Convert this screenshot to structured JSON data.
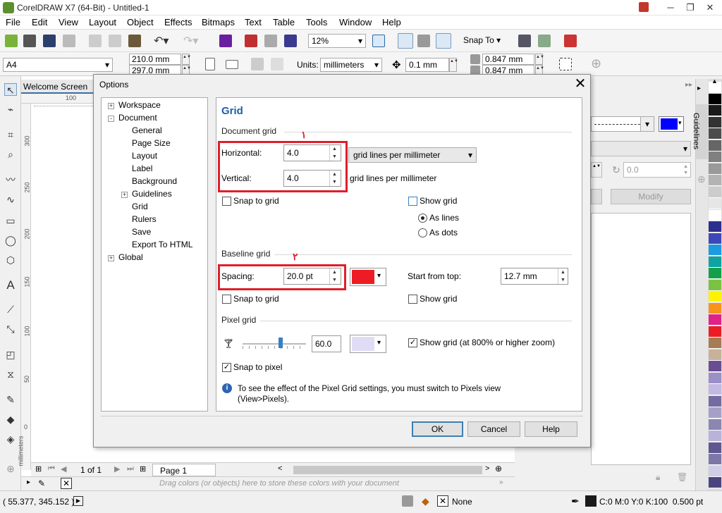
{
  "window": {
    "title": "CorelDRAW X7 (64-Bit) - Untitled-1"
  },
  "menu": [
    "File",
    "Edit",
    "View",
    "Layout",
    "Object",
    "Effects",
    "Bitmaps",
    "Text",
    "Table",
    "Tools",
    "Window",
    "Help"
  ],
  "toolbar": {
    "zoom": "12%",
    "snap_to": "Snap To"
  },
  "propbar": {
    "page_size": "A4",
    "width": "210.0 mm",
    "height": "297.0 mm",
    "units_label": "Units:",
    "units_value": "millimeters",
    "nudge": "0.1 mm",
    "dup_x": "0.847 mm",
    "dup_y": "0.847 mm"
  },
  "tabs": {
    "welcome": "Welcome Screen"
  },
  "ruler": {
    "h_100": "100",
    "v_labels": [
      "300",
      "250",
      "200",
      "150",
      "100",
      "50",
      "0"
    ],
    "v_unit": "millimeters"
  },
  "docker": {
    "title": "Guidelines",
    "angle": "0.0",
    "modify": "Modify"
  },
  "pagenav": {
    "count": "1 of 1",
    "page": "Page 1"
  },
  "colorbar": {
    "hint": "Drag colors (or objects) here to store these colors with your document"
  },
  "status": {
    "coords": "( 55.377, 345.152 )",
    "fill": "None",
    "outline": "C:0 M:0 Y:0 K:100  0.500 pt"
  },
  "palette": [
    "#ffffff",
    "#000000",
    "#1a1a1a",
    "#333333",
    "#4d4d4d",
    "#666666",
    "#808080",
    "#999999",
    "#b3b3b3",
    "#cccccc",
    "#e6e6e6",
    "#ffffff",
    "#2b2f8f",
    "#3d48b8",
    "#1c9be0",
    "#0fa3a3",
    "#12a04a",
    "#7cc242",
    "#fff200",
    "#f7941d",
    "#e0218a",
    "#ed1c24",
    "#a67c52",
    "#c7b299",
    "#6a4c93",
    "#9b8fc7",
    "#c3b9e3",
    "#736ca3",
    "#a6a0c9",
    "#8c86b3",
    "#b9b3d9",
    "#5f5890",
    "#7d77a8",
    "#d0cde6",
    "#4a4580"
  ],
  "dialog": {
    "title": "Options",
    "tree": [
      {
        "label": "Workspace",
        "level": 0,
        "exp": "+"
      },
      {
        "label": "Document",
        "level": 0,
        "exp": "-"
      },
      {
        "label": "General",
        "level": 1
      },
      {
        "label": "Page Size",
        "level": 1
      },
      {
        "label": "Layout",
        "level": 1
      },
      {
        "label": "Label",
        "level": 1
      },
      {
        "label": "Background",
        "level": 1
      },
      {
        "label": "Guidelines",
        "level": 1,
        "exp": "+"
      },
      {
        "label": "Grid",
        "level": 1
      },
      {
        "label": "Rulers",
        "level": 1
      },
      {
        "label": "Save",
        "level": 1
      },
      {
        "label": "Export To HTML",
        "level": 1
      },
      {
        "label": "Global",
        "level": 0,
        "exp": "+"
      }
    ],
    "heading": "Grid",
    "document_grid": {
      "section": "Document grid",
      "marker": "١",
      "horizontal_label": "Horizontal:",
      "horizontal_value": "4.0",
      "vertical_label": "Vertical:",
      "vertical_value": "4.0",
      "units_select": "grid lines per millimeter",
      "units_text": "grid lines per millimeter",
      "snap": "Snap to grid",
      "show": "Show grid",
      "as_lines": "As lines",
      "as_dots": "As dots"
    },
    "baseline_grid": {
      "section": "Baseline grid",
      "marker": "٢",
      "spacing_label": "Spacing:",
      "spacing_value": "20.0 pt",
      "color": "#ed1c24",
      "start_label": "Start from top:",
      "start_value": "12.7 mm",
      "snap": "Snap to grid",
      "show": "Show grid"
    },
    "pixel_grid": {
      "section": "Pixel grid",
      "opacity": "60.0",
      "opacity_level": 60,
      "color": "#e0dcf6",
      "show": "Show grid (at 800% or higher zoom)",
      "snap": "Snap to pixel",
      "info_line1": "To see the effect of the Pixel Grid settings, you must switch to Pixels view",
      "info_line2": "(View>Pixels)."
    },
    "buttons": {
      "ok": "OK",
      "cancel": "Cancel",
      "help": "Help"
    }
  }
}
